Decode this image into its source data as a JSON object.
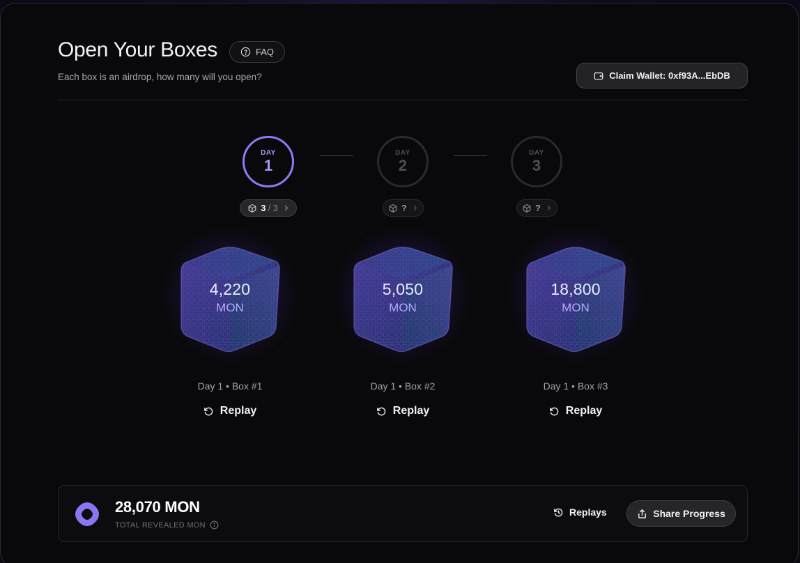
{
  "header": {
    "title": "Open Your Boxes",
    "faq_label": "FAQ",
    "subtitle": "Each box is an airdrop, how many will you open?",
    "wallet_label": "Claim Wallet: 0xf93A...EbDB"
  },
  "days": [
    {
      "label": "DAY",
      "number": "1",
      "active": true,
      "box_count": "3",
      "box_sep": " / ",
      "box_total": "3"
    },
    {
      "label": "DAY",
      "number": "2",
      "active": false,
      "box_count": "?"
    },
    {
      "label": "DAY",
      "number": "3",
      "active": false,
      "box_count": "?"
    }
  ],
  "boxes": [
    {
      "amount": "4,220",
      "unit": "MON",
      "label": "Day 1 • Box #1",
      "replay_label": "Replay"
    },
    {
      "amount": "5,050",
      "unit": "MON",
      "label": "Day 1 • Box #2",
      "replay_label": "Replay"
    },
    {
      "amount": "18,800",
      "unit": "MON",
      "label": "Day 1 • Box #3",
      "replay_label": "Replay"
    }
  ],
  "footer": {
    "total_value": "28,070 MON",
    "total_label": "TOTAL REVEALED MON",
    "replays_label": "Replays",
    "share_label": "Share Progress"
  },
  "colors": {
    "accent": "#8d7bf5",
    "background": "#09090b",
    "box_glow": "#623cdc"
  },
  "icons": [
    "help-circle-icon",
    "wallet-icon",
    "box-icon",
    "chevron-right-icon",
    "rotate-ccw-icon",
    "history-icon",
    "share-icon",
    "info-icon",
    "monad-logo"
  ]
}
